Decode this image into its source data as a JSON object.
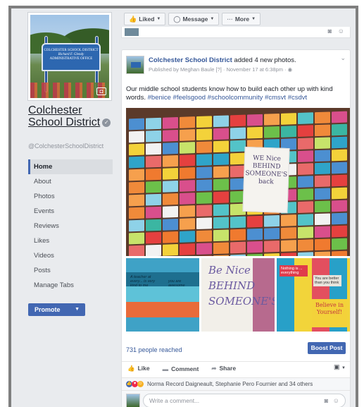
{
  "topbar": {
    "liked_label": "Liked",
    "message_label": "Message",
    "more_label": "More",
    "liked_icon": "thumbs-up-icon",
    "message_icon": "chat-icon",
    "more_icon": "ellipsis-icon"
  },
  "sidebar": {
    "cover_sign_line1": "COLCHESTER SCHOOL DISTRICT",
    "cover_sign_line2": "Richard F. Glendy",
    "cover_sign_line3": "ADMINISTRATIVE OFFICE",
    "page_name": "Colchester School District",
    "handle": "@ColchesterSchoolDistrict",
    "nav": [
      {
        "label": "Home",
        "active": true
      },
      {
        "label": "About"
      },
      {
        "label": "Photos"
      },
      {
        "label": "Events"
      },
      {
        "label": "Reviews"
      },
      {
        "label": "Likes"
      },
      {
        "label": "Videos"
      },
      {
        "label": "Posts"
      },
      {
        "label": "Manage Tabs"
      }
    ],
    "promote_label": "Promote"
  },
  "post": {
    "author": "Colchester School District",
    "action": " added 4 new photos.",
    "meta": "Published by Meghan Baule [?] · November 17 at 6:38pm · ",
    "text": "Our middle school students know how to build each other up with kind words. ",
    "hashtags": "#benice #feelsgood #schoolcommunity #cmsvt #csdvt",
    "main_photo_card": "WE Nice BEHIND SOMEONE'S back",
    "photo2_text": "Be Nice BEHIND SOMEONE'S",
    "photo3_card": "Believe in Yourself!",
    "people_reached": "731 people reached",
    "boost_label": "Boost Post",
    "like_label": "Like",
    "comment_label": "Comment",
    "share_label": "Share",
    "reactions_text": "Norma Record Daigneault, Stephanie Pero Fournier and 34 others",
    "comment_placeholder": "Write a comment..."
  },
  "colors": {
    "brand_blue": "#4267b2",
    "link_blue": "#365899",
    "page_bg": "#e9ebee"
  }
}
